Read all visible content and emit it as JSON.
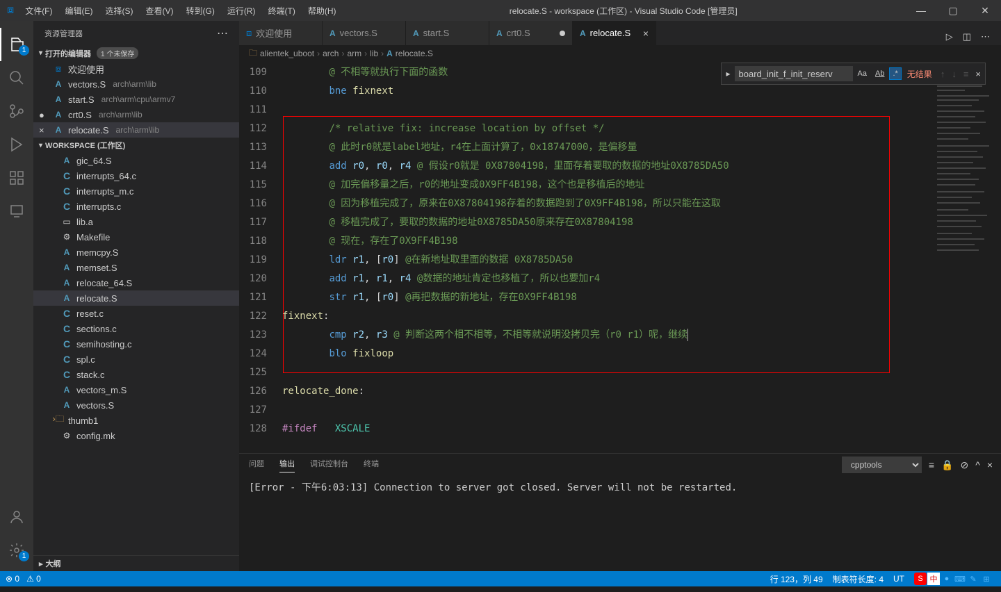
{
  "title": "relocate.S - workspace (工作区) - Visual Studio Code [管理员]",
  "menu": [
    "文件(F)",
    "编辑(E)",
    "选择(S)",
    "查看(V)",
    "转到(G)",
    "运行(R)",
    "终端(T)",
    "帮助(H)"
  ],
  "explorer": {
    "title": "资源管理器"
  },
  "open_editors": {
    "title": "打开的编辑器",
    "unsaved": "1 个未保存",
    "items": [
      {
        "icon": "vs",
        "label": "欢迎使用",
        "close": ""
      },
      {
        "icon": "a",
        "label": "vectors.S",
        "sub": "arch\\arm\\lib",
        "close": ""
      },
      {
        "icon": "a",
        "label": "start.S",
        "sub": "arch\\arm\\cpu\\armv7",
        "close": ""
      },
      {
        "icon": "a",
        "label": "crt0.S",
        "sub": "arch\\arm\\lib",
        "close": "●"
      },
      {
        "icon": "a",
        "label": "relocate.S",
        "sub": "arch\\arm\\lib",
        "close": "×",
        "active": true
      }
    ]
  },
  "workspace": {
    "title": "WORKSPACE (工作区)",
    "items": [
      {
        "icon": "a",
        "label": "gic_64.S"
      },
      {
        "icon": "c",
        "label": "interrupts_64.c"
      },
      {
        "icon": "c",
        "label": "interrupts_m.c"
      },
      {
        "icon": "c",
        "label": "interrupts.c"
      },
      {
        "icon": "f",
        "label": "lib.a"
      },
      {
        "icon": "g",
        "label": "Makefile"
      },
      {
        "icon": "a",
        "label": "memcpy.S"
      },
      {
        "icon": "a",
        "label": "memset.S"
      },
      {
        "icon": "a",
        "label": "relocate_64.S"
      },
      {
        "icon": "a",
        "label": "relocate.S",
        "active": true
      },
      {
        "icon": "c",
        "label": "reset.c"
      },
      {
        "icon": "c",
        "label": "sections.c"
      },
      {
        "icon": "c",
        "label": "semihosting.c"
      },
      {
        "icon": "c",
        "label": "spl.c"
      },
      {
        "icon": "c",
        "label": "stack.c"
      },
      {
        "icon": "a",
        "label": "vectors_m.S"
      },
      {
        "icon": "a",
        "label": "vectors.S"
      },
      {
        "icon": "folder",
        "label": "thumb1"
      },
      {
        "icon": "g",
        "label": "config.mk"
      }
    ]
  },
  "outline": "大纲",
  "tabs": [
    {
      "icon": "vs",
      "label": "欢迎使用"
    },
    {
      "icon": "a",
      "label": "vectors.S"
    },
    {
      "icon": "a",
      "label": "start.S"
    },
    {
      "icon": "a",
      "label": "crt0.S",
      "dirty": true
    },
    {
      "icon": "a",
      "label": "relocate.S",
      "active": true
    }
  ],
  "breadcrumb": [
    "alientek_uboot",
    "arch",
    "arm",
    "lib",
    "relocate.S"
  ],
  "find": {
    "value": "board_init_f_init_reserv",
    "result": "无结果"
  },
  "line_start": 109,
  "code_lines": [
    {
      "ind": 2,
      "parts": [
        {
          "c": "cmt",
          "t": "@ 不相等就执行下面的函数"
        }
      ]
    },
    {
      "ind": 2,
      "parts": [
        {
          "c": "kw",
          "t": "bne"
        },
        {
          "c": "",
          "t": " "
        },
        {
          "c": "lbl",
          "t": "fixnext"
        }
      ]
    },
    {
      "ind": 0,
      "parts": []
    },
    {
      "ind": 2,
      "parts": [
        {
          "c": "cmt",
          "t": "/* relative fix: increase location by offset */"
        }
      ]
    },
    {
      "ind": 2,
      "parts": [
        {
          "c": "cmt",
          "t": "@ 此时r0就是label地址，r4在上面计算了，0x18747000，是偏移量"
        }
      ]
    },
    {
      "ind": 2,
      "parts": [
        {
          "c": "kw",
          "t": "add"
        },
        {
          "c": "",
          "t": " "
        },
        {
          "c": "reg",
          "t": "r0"
        },
        {
          "c": "pnc",
          "t": ", "
        },
        {
          "c": "reg",
          "t": "r0"
        },
        {
          "c": "pnc",
          "t": ", "
        },
        {
          "c": "reg",
          "t": "r4"
        },
        {
          "c": "",
          "t": " "
        },
        {
          "c": "cmt",
          "t": "@ 假设r0就是 0X87804198，里面存着要取的数据的地址0X8785DA50"
        }
      ]
    },
    {
      "ind": 2,
      "parts": [
        {
          "c": "cmt",
          "t": "@ 加完偏移量之后，r0的地址变成0X9FF4B198，这个也是移植后的地址"
        }
      ]
    },
    {
      "ind": 2,
      "parts": [
        {
          "c": "cmt",
          "t": "@ 因为移植完成了，原来在0X87804198存着的数据跑到了0X9FF4B198，所以只能在这取"
        }
      ]
    },
    {
      "ind": 2,
      "parts": [
        {
          "c": "cmt",
          "t": "@ 移植完成了，要取的数据的地址0X8785DA50原来存在0X87804198"
        }
      ]
    },
    {
      "ind": 2,
      "parts": [
        {
          "c": "cmt",
          "t": "@ 现在，存在了0X9FF4B198"
        }
      ]
    },
    {
      "ind": 2,
      "parts": [
        {
          "c": "kw",
          "t": "ldr"
        },
        {
          "c": "",
          "t": " "
        },
        {
          "c": "reg",
          "t": "r1"
        },
        {
          "c": "pnc",
          "t": ", ["
        },
        {
          "c": "reg",
          "t": "r0"
        },
        {
          "c": "pnc",
          "t": "]"
        },
        {
          "c": "",
          "t": " "
        },
        {
          "c": "cmt",
          "t": "@在新地址取里面的数据 0X8785DA50"
        }
      ]
    },
    {
      "ind": 2,
      "parts": [
        {
          "c": "kw",
          "t": "add"
        },
        {
          "c": "",
          "t": " "
        },
        {
          "c": "reg",
          "t": "r1"
        },
        {
          "c": "pnc",
          "t": ", "
        },
        {
          "c": "reg",
          "t": "r1"
        },
        {
          "c": "pnc",
          "t": ", "
        },
        {
          "c": "reg",
          "t": "r4"
        },
        {
          "c": "",
          "t": " "
        },
        {
          "c": "cmt",
          "t": "@数据的地址肯定也移植了，所以也要加r4"
        }
      ]
    },
    {
      "ind": 2,
      "parts": [
        {
          "c": "kw",
          "t": "str"
        },
        {
          "c": "",
          "t": " "
        },
        {
          "c": "reg",
          "t": "r1"
        },
        {
          "c": "pnc",
          "t": ", ["
        },
        {
          "c": "reg",
          "t": "r0"
        },
        {
          "c": "pnc",
          "t": "]"
        },
        {
          "c": "",
          "t": " "
        },
        {
          "c": "cmt",
          "t": "@再把数据的新地址，存在0X9FF4B198"
        }
      ]
    },
    {
      "ind": 0,
      "parts": [
        {
          "c": "lbl",
          "t": "fixnext"
        },
        {
          "c": "pnc",
          "t": ":"
        }
      ]
    },
    {
      "ind": 2,
      "parts": [
        {
          "c": "kw",
          "t": "cmp"
        },
        {
          "c": "",
          "t": " "
        },
        {
          "c": "reg",
          "t": "r2"
        },
        {
          "c": "pnc",
          "t": ", "
        },
        {
          "c": "reg",
          "t": "r3"
        },
        {
          "c": "",
          "t": " "
        },
        {
          "c": "cmt",
          "t": "@ 判断这两个相不相等，不相等就说明没拷贝完（r0 r1）呢，继续"
        }
      ],
      "cursor": true
    },
    {
      "ind": 2,
      "parts": [
        {
          "c": "kw",
          "t": "blo"
        },
        {
          "c": "",
          "t": " "
        },
        {
          "c": "lbl",
          "t": "fixloop"
        }
      ]
    },
    {
      "ind": 0,
      "parts": []
    },
    {
      "ind": 0,
      "parts": [
        {
          "c": "lbl",
          "t": "relocate_done"
        },
        {
          "c": "pnc",
          "t": ":"
        }
      ]
    },
    {
      "ind": 0,
      "parts": []
    },
    {
      "ind": 0,
      "parts": [
        {
          "c": "dir",
          "t": "#ifdef"
        },
        {
          "c": "",
          "t": "   "
        },
        {
          "c": "cnst",
          "t": "XSCALE"
        }
      ]
    }
  ],
  "panel": {
    "tabs": [
      "问题",
      "输出",
      "调试控制台",
      "终端"
    ],
    "active": 1,
    "select": "cpptools",
    "content": "[Error - 下午6:03:13] Connection to server got closed. Server will not be restarted."
  },
  "status": {
    "errors": "0",
    "warnings": "0",
    "position": "行 123，列 49",
    "tab": "制表符长度: 4",
    "encoding": "UT"
  }
}
